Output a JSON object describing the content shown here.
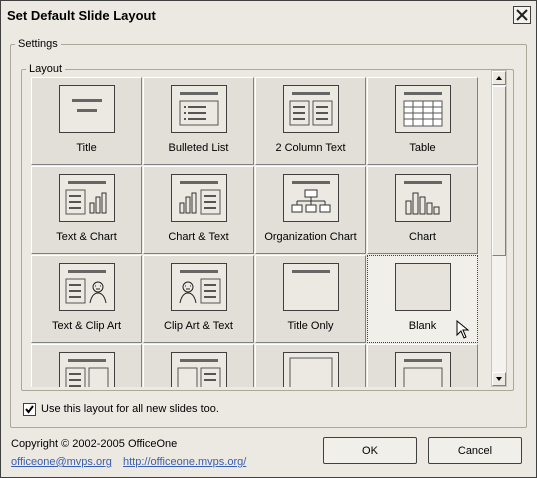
{
  "window": {
    "title": "Set Default Slide Layout"
  },
  "settings": {
    "group_label": "Settings"
  },
  "layout": {
    "group_label": "Layout",
    "tiles": [
      {
        "label": "Title"
      },
      {
        "label": "Bulleted List"
      },
      {
        "label": "2 Column Text"
      },
      {
        "label": "Table"
      },
      {
        "label": "Text & Chart"
      },
      {
        "label": "Chart & Text"
      },
      {
        "label": "Organization Chart"
      },
      {
        "label": "Chart"
      },
      {
        "label": "Text & Clip Art"
      },
      {
        "label": "Clip Art & Text"
      },
      {
        "label": "Title Only"
      },
      {
        "label": "Blank"
      },
      {
        "label": ""
      },
      {
        "label": ""
      },
      {
        "label": ""
      },
      {
        "label": ""
      }
    ],
    "selected": "Blank"
  },
  "checkbox": {
    "label": "Use this layout for all new slides too.",
    "checked": true
  },
  "footer": {
    "copyright": "Copyright © 2002-2005 OfficeOne",
    "email": "officeone@mvps.org",
    "url": "http://officeone.mvps.org/"
  },
  "buttons": {
    "ok": "OK",
    "cancel": "Cancel"
  }
}
